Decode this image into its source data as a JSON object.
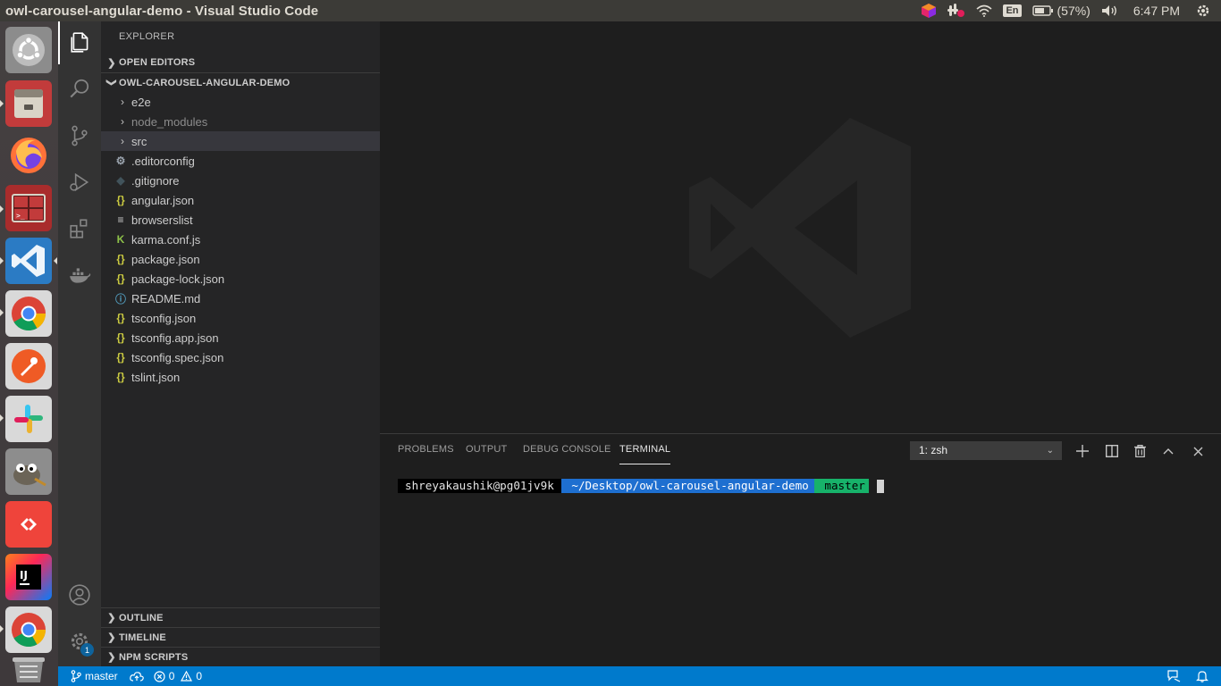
{
  "window": {
    "title": "owl-carousel-angular-demo - Visual Studio Code"
  },
  "system_tray": {
    "keyboard_layout": "En",
    "battery": "(57%)",
    "clock": "6:47 PM"
  },
  "sidebar": {
    "title": "EXPLORER",
    "open_editors": "OPEN EDITORS",
    "project": "OWL-CAROUSEL-ANGULAR-DEMO",
    "folders": [
      {
        "name": "e2e"
      },
      {
        "name": "node_modules"
      },
      {
        "name": "src"
      }
    ],
    "files": [
      {
        "name": ".editorconfig",
        "icon": "gear-icon"
      },
      {
        "name": ".gitignore",
        "icon": "git-icon"
      },
      {
        "name": "angular.json",
        "icon": "json-braces-icon"
      },
      {
        "name": "browserslist",
        "icon": "lines-icon"
      },
      {
        "name": "karma.conf.js",
        "icon": "karma-icon"
      },
      {
        "name": "package.json",
        "icon": "json-braces-icon"
      },
      {
        "name": "package-lock.json",
        "icon": "json-braces-icon"
      },
      {
        "name": "README.md",
        "icon": "info-icon"
      },
      {
        "name": "tsconfig.json",
        "icon": "json-braces-icon"
      },
      {
        "name": "tsconfig.app.json",
        "icon": "json-braces-icon"
      },
      {
        "name": "tsconfig.spec.json",
        "icon": "json-braces-icon"
      },
      {
        "name": "tslint.json",
        "icon": "json-braces-icon"
      }
    ],
    "outline": "OUTLINE",
    "timeline": "TIMELINE",
    "npm_scripts": "NPM SCRIPTS"
  },
  "activity_bar": {
    "settings_badge": "1"
  },
  "panel": {
    "tabs": [
      "PROBLEMS",
      "OUTPUT",
      "DEBUG CONSOLE",
      "TERMINAL"
    ],
    "active_tab": "TERMINAL",
    "terminal_select": "1: zsh",
    "prompt": {
      "user": "shreyakaushik@pg01jv9k",
      "path": " ~/Desktop/owl-carousel-angular-demo",
      "branch": " master"
    }
  },
  "statusbar": {
    "branch": "master",
    "errors": "0",
    "warnings": "0"
  },
  "colors": {
    "statusbar": "#007acc",
    "activity_bar": "#333333",
    "sidebar": "#252526",
    "editor": "#1e1e1e",
    "json_icon": "#cbcb41"
  }
}
